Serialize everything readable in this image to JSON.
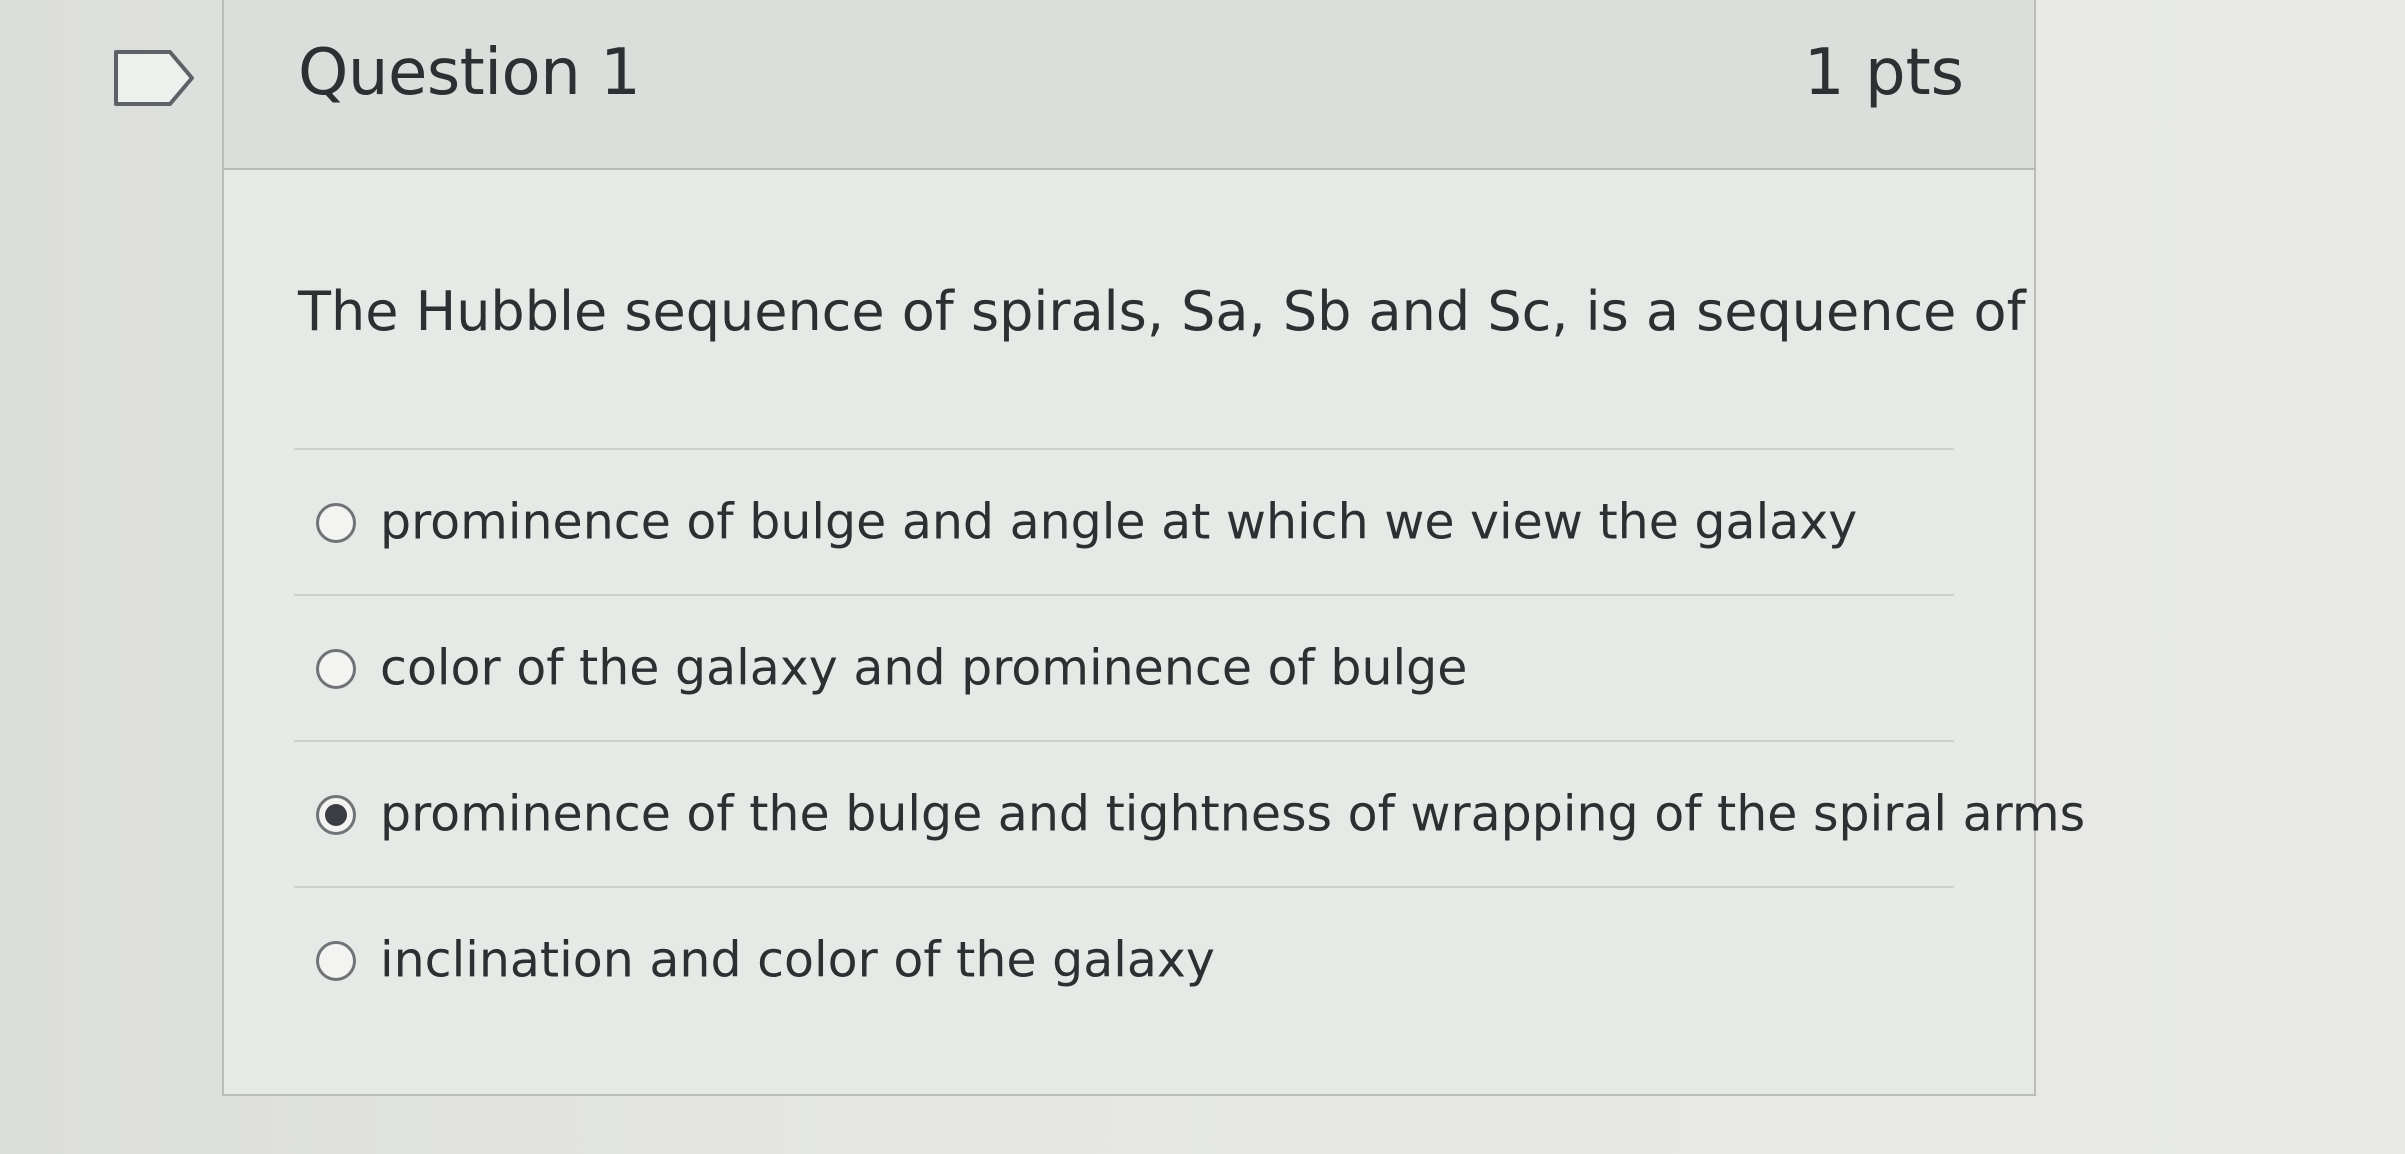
{
  "question": {
    "title": "Question 1",
    "points": "1 pts",
    "text": "The Hubble sequence of spirals, Sa, Sb and Sc, is a sequence of",
    "flag_icon": "flag-outline-icon"
  },
  "answers": [
    {
      "label": "prominence of bulge and angle at which we view the galaxy",
      "selected": false
    },
    {
      "label": "color of the galaxy and prominence of bulge",
      "selected": false
    },
    {
      "label": "prominence of the bulge and tightness of wrapping of the spiral arms",
      "selected": true
    },
    {
      "label": "inclination and color of the galaxy",
      "selected": false
    }
  ],
  "colors": {
    "text": "#2d3033",
    "header_bg": "#dcdedc",
    "border": "#b9bcb9"
  }
}
